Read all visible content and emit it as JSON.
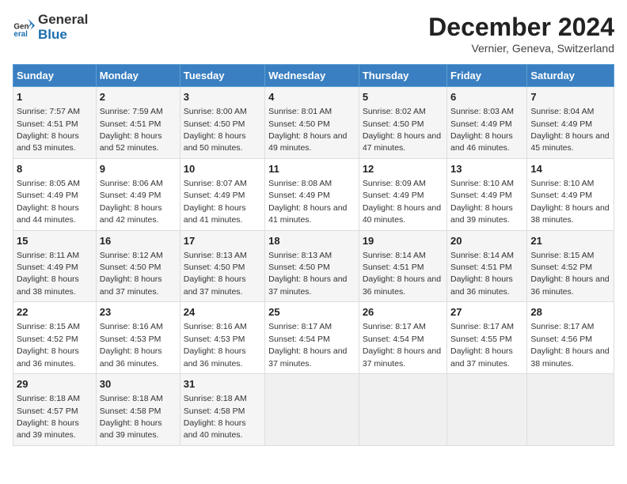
{
  "logo": {
    "text_general": "General",
    "text_blue": "Blue"
  },
  "title": "December 2024",
  "subtitle": "Vernier, Geneva, Switzerland",
  "days_of_week": [
    "Sunday",
    "Monday",
    "Tuesday",
    "Wednesday",
    "Thursday",
    "Friday",
    "Saturday"
  ],
  "weeks": [
    [
      {
        "day": "1",
        "sunrise": "Sunrise: 7:57 AM",
        "sunset": "Sunset: 4:51 PM",
        "daylight": "Daylight: 8 hours and 53 minutes."
      },
      {
        "day": "2",
        "sunrise": "Sunrise: 7:59 AM",
        "sunset": "Sunset: 4:51 PM",
        "daylight": "Daylight: 8 hours and 52 minutes."
      },
      {
        "day": "3",
        "sunrise": "Sunrise: 8:00 AM",
        "sunset": "Sunset: 4:50 PM",
        "daylight": "Daylight: 8 hours and 50 minutes."
      },
      {
        "day": "4",
        "sunrise": "Sunrise: 8:01 AM",
        "sunset": "Sunset: 4:50 PM",
        "daylight": "Daylight: 8 hours and 49 minutes."
      },
      {
        "day": "5",
        "sunrise": "Sunrise: 8:02 AM",
        "sunset": "Sunset: 4:50 PM",
        "daylight": "Daylight: 8 hours and 47 minutes."
      },
      {
        "day": "6",
        "sunrise": "Sunrise: 8:03 AM",
        "sunset": "Sunset: 4:49 PM",
        "daylight": "Daylight: 8 hours and 46 minutes."
      },
      {
        "day": "7",
        "sunrise": "Sunrise: 8:04 AM",
        "sunset": "Sunset: 4:49 PM",
        "daylight": "Daylight: 8 hours and 45 minutes."
      }
    ],
    [
      {
        "day": "8",
        "sunrise": "Sunrise: 8:05 AM",
        "sunset": "Sunset: 4:49 PM",
        "daylight": "Daylight: 8 hours and 44 minutes."
      },
      {
        "day": "9",
        "sunrise": "Sunrise: 8:06 AM",
        "sunset": "Sunset: 4:49 PM",
        "daylight": "Daylight: 8 hours and 42 minutes."
      },
      {
        "day": "10",
        "sunrise": "Sunrise: 8:07 AM",
        "sunset": "Sunset: 4:49 PM",
        "daylight": "Daylight: 8 hours and 41 minutes."
      },
      {
        "day": "11",
        "sunrise": "Sunrise: 8:08 AM",
        "sunset": "Sunset: 4:49 PM",
        "daylight": "Daylight: 8 hours and 41 minutes."
      },
      {
        "day": "12",
        "sunrise": "Sunrise: 8:09 AM",
        "sunset": "Sunset: 4:49 PM",
        "daylight": "Daylight: 8 hours and 40 minutes."
      },
      {
        "day": "13",
        "sunrise": "Sunrise: 8:10 AM",
        "sunset": "Sunset: 4:49 PM",
        "daylight": "Daylight: 8 hours and 39 minutes."
      },
      {
        "day": "14",
        "sunrise": "Sunrise: 8:10 AM",
        "sunset": "Sunset: 4:49 PM",
        "daylight": "Daylight: 8 hours and 38 minutes."
      }
    ],
    [
      {
        "day": "15",
        "sunrise": "Sunrise: 8:11 AM",
        "sunset": "Sunset: 4:49 PM",
        "daylight": "Daylight: 8 hours and 38 minutes."
      },
      {
        "day": "16",
        "sunrise": "Sunrise: 8:12 AM",
        "sunset": "Sunset: 4:50 PM",
        "daylight": "Daylight: 8 hours and 37 minutes."
      },
      {
        "day": "17",
        "sunrise": "Sunrise: 8:13 AM",
        "sunset": "Sunset: 4:50 PM",
        "daylight": "Daylight: 8 hours and 37 minutes."
      },
      {
        "day": "18",
        "sunrise": "Sunrise: 8:13 AM",
        "sunset": "Sunset: 4:50 PM",
        "daylight": "Daylight: 8 hours and 37 minutes."
      },
      {
        "day": "19",
        "sunrise": "Sunrise: 8:14 AM",
        "sunset": "Sunset: 4:51 PM",
        "daylight": "Daylight: 8 hours and 36 minutes."
      },
      {
        "day": "20",
        "sunrise": "Sunrise: 8:14 AM",
        "sunset": "Sunset: 4:51 PM",
        "daylight": "Daylight: 8 hours and 36 minutes."
      },
      {
        "day": "21",
        "sunrise": "Sunrise: 8:15 AM",
        "sunset": "Sunset: 4:52 PM",
        "daylight": "Daylight: 8 hours and 36 minutes."
      }
    ],
    [
      {
        "day": "22",
        "sunrise": "Sunrise: 8:15 AM",
        "sunset": "Sunset: 4:52 PM",
        "daylight": "Daylight: 8 hours and 36 minutes."
      },
      {
        "day": "23",
        "sunrise": "Sunrise: 8:16 AM",
        "sunset": "Sunset: 4:53 PM",
        "daylight": "Daylight: 8 hours and 36 minutes."
      },
      {
        "day": "24",
        "sunrise": "Sunrise: 8:16 AM",
        "sunset": "Sunset: 4:53 PM",
        "daylight": "Daylight: 8 hours and 36 minutes."
      },
      {
        "day": "25",
        "sunrise": "Sunrise: 8:17 AM",
        "sunset": "Sunset: 4:54 PM",
        "daylight": "Daylight: 8 hours and 37 minutes."
      },
      {
        "day": "26",
        "sunrise": "Sunrise: 8:17 AM",
        "sunset": "Sunset: 4:54 PM",
        "daylight": "Daylight: 8 hours and 37 minutes."
      },
      {
        "day": "27",
        "sunrise": "Sunrise: 8:17 AM",
        "sunset": "Sunset: 4:55 PM",
        "daylight": "Daylight: 8 hours and 37 minutes."
      },
      {
        "day": "28",
        "sunrise": "Sunrise: 8:17 AM",
        "sunset": "Sunset: 4:56 PM",
        "daylight": "Daylight: 8 hours and 38 minutes."
      }
    ],
    [
      {
        "day": "29",
        "sunrise": "Sunrise: 8:18 AM",
        "sunset": "Sunset: 4:57 PM",
        "daylight": "Daylight: 8 hours and 39 minutes."
      },
      {
        "day": "30",
        "sunrise": "Sunrise: 8:18 AM",
        "sunset": "Sunset: 4:58 PM",
        "daylight": "Daylight: 8 hours and 39 minutes."
      },
      {
        "day": "31",
        "sunrise": "Sunrise: 8:18 AM",
        "sunset": "Sunset: 4:58 PM",
        "daylight": "Daylight: 8 hours and 40 minutes."
      },
      null,
      null,
      null,
      null
    ]
  ]
}
